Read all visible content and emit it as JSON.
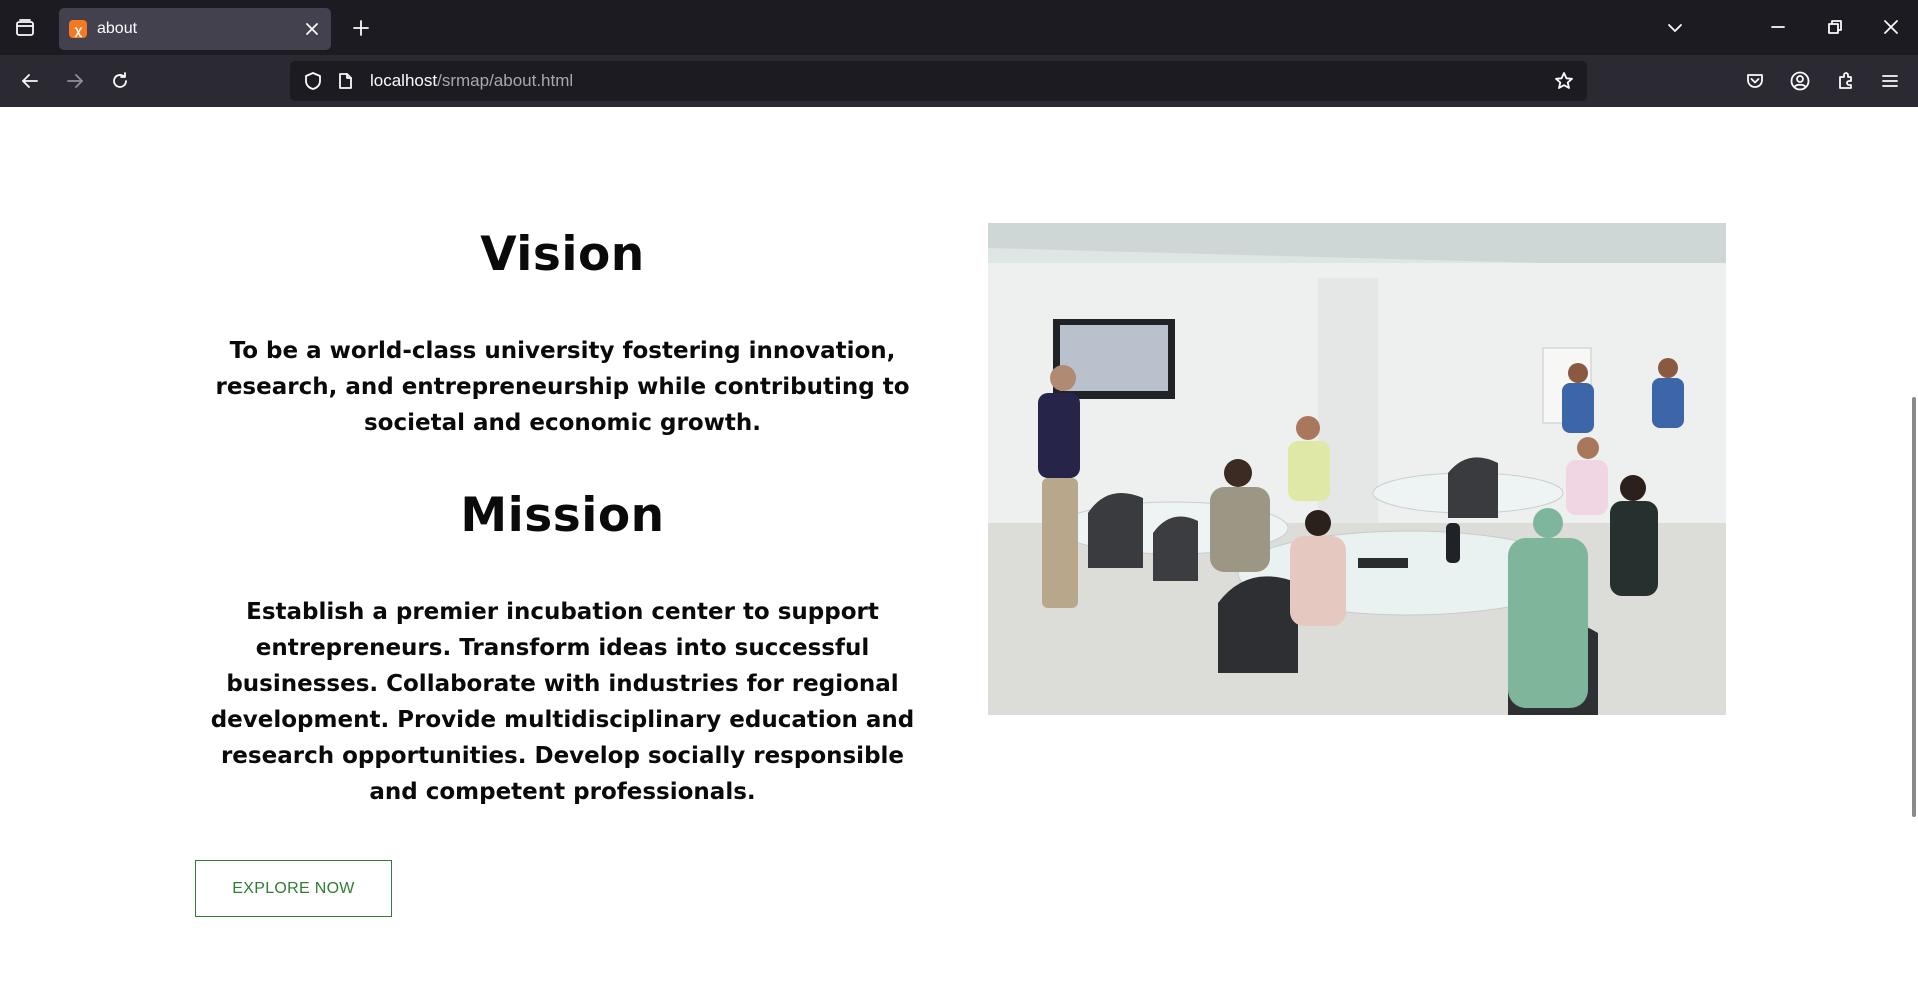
{
  "browser": {
    "tab": {
      "title": "about",
      "favicon": "xampp-icon"
    },
    "url": {
      "host": "localhost",
      "path": "/srmap/about.html"
    },
    "colors": {
      "tabstrip": "#1c1b22",
      "navbar": "#2b2a33",
      "active_tab": "#42414d"
    }
  },
  "page": {
    "vision": {
      "title": "Vision",
      "text": "To be a world-class university fostering innovation, research, and entrepreneurship while contributing to societal and economic growth."
    },
    "mission": {
      "title": "Mission",
      "text": "Establish a premier incubation center to support entrepreneurs. Transform ideas into successful businesses. Collaborate with industries for regional development. Provide multidisciplinary education and research opportunities. Develop socially responsible and competent professionals."
    },
    "cta": {
      "label": "EXPLORE NOW",
      "color": "#2e7d32"
    },
    "image": {
      "subject": "classroom-meeting-photo"
    }
  }
}
